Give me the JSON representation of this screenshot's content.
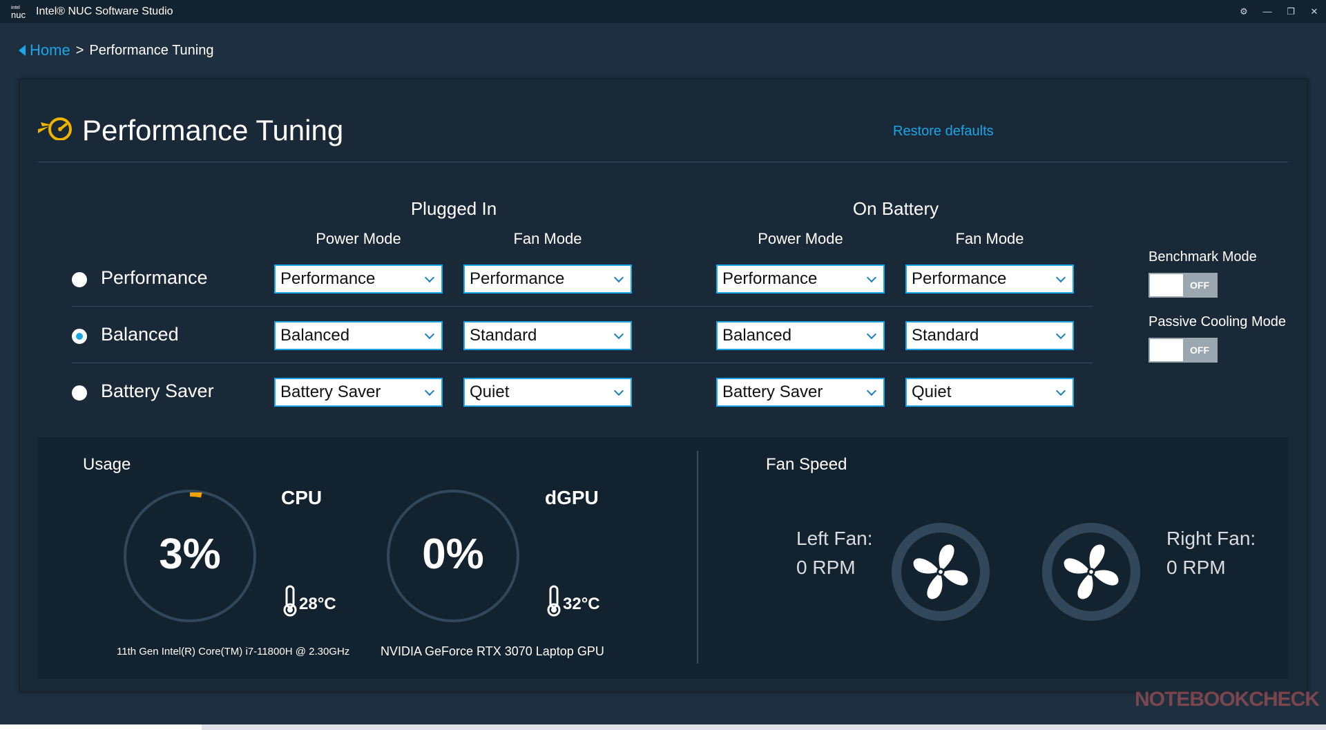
{
  "window": {
    "logo_line1": "intel",
    "logo_line2": "nuc",
    "title": "Intel® NUC Software Studio",
    "controls": [
      "⚙",
      "—",
      "❐",
      "✕"
    ]
  },
  "breadcrumb": {
    "home": "Home",
    "separator": ">",
    "current": "Performance Tuning"
  },
  "header": {
    "title": "Performance Tuning",
    "restore": "Restore defaults",
    "icon": "speedometer-icon"
  },
  "groups": {
    "plugged": "Plugged In",
    "battery": "On Battery",
    "power_mode": "Power Mode",
    "fan_mode": "Fan Mode"
  },
  "rows": [
    {
      "label": "Performance",
      "selected": false,
      "plugged_power": "Performance",
      "plugged_fan": "Performance",
      "battery_power": "Performance",
      "battery_fan": "Performance"
    },
    {
      "label": "Balanced",
      "selected": true,
      "plugged_power": "Balanced",
      "plugged_fan": "Standard",
      "battery_power": "Balanced",
      "battery_fan": "Standard"
    },
    {
      "label": "Battery Saver",
      "selected": false,
      "plugged_power": "Battery Saver",
      "plugged_fan": "Quiet",
      "battery_power": "Battery Saver",
      "battery_fan": "Quiet"
    }
  ],
  "side": {
    "benchmark_label": "Benchmark Mode",
    "benchmark_state": "OFF",
    "passive_label": "Passive Cooling Mode",
    "passive_state": "OFF"
  },
  "usage": {
    "title": "Usage",
    "cpu": {
      "name": "CPU",
      "percent": "3%",
      "percent_value": 3,
      "temp": "28°C",
      "desc": "11th Gen Intel(R) Core(TM) i7-11800H @ 2.30GHz"
    },
    "gpu": {
      "name": "dGPU",
      "percent": "0%",
      "percent_value": 0,
      "temp": "32°C",
      "desc": "NVIDIA GeForce RTX 3070 Laptop GPU"
    }
  },
  "fans": {
    "title": "Fan Speed",
    "left_label": "Left Fan:",
    "left_rpm": "0 RPM",
    "right_label": "Right Fan:",
    "right_rpm": "0 RPM"
  },
  "watermark": "NOTEBOOKCHECK",
  "colors": {
    "accent": "#1aa6e8",
    "cpu_usage_arc": "#f0a000",
    "background": "#1e2f40"
  }
}
